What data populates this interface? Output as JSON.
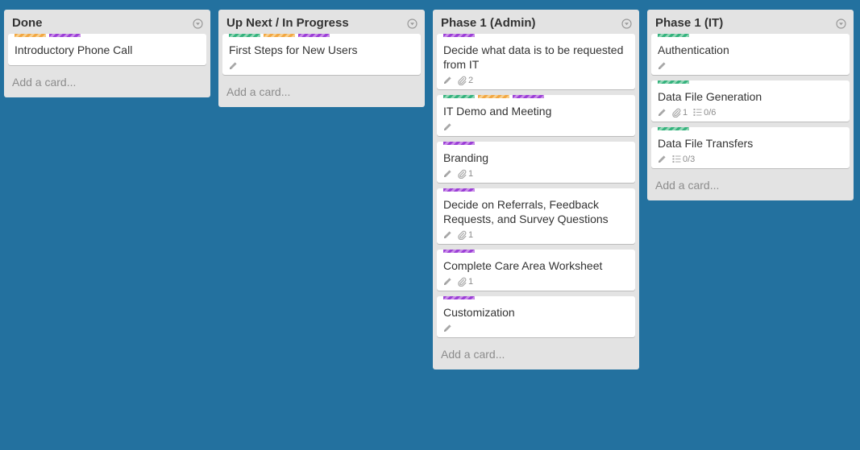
{
  "colors": {
    "board_background": "#23719f",
    "list_background": "#e3e3e3",
    "label_orange": "#f2a743",
    "label_purple": "#9b3ed6",
    "label_green": "#34b27d"
  },
  "add_card_label": "Add a card...",
  "lists": [
    {
      "title": "Done",
      "cards": [
        {
          "title": "Introductory Phone Call",
          "labels": [
            "orange",
            "purple"
          ],
          "badges": null
        }
      ]
    },
    {
      "title": "Up Next / In Progress",
      "cards": [
        {
          "title": "First Steps for New Users",
          "labels": [
            "green",
            "orange",
            "purple"
          ],
          "badges": {
            "description": true,
            "attachments": null,
            "checklist": null
          }
        }
      ]
    },
    {
      "title": "Phase 1 (Admin)",
      "cards": [
        {
          "title": "Decide what data is to be requested from IT",
          "labels": [
            "purple"
          ],
          "badges": {
            "description": true,
            "attachments": "2",
            "checklist": null
          }
        },
        {
          "title": "IT Demo and Meeting",
          "labels": [
            "green",
            "orange",
            "purple"
          ],
          "badges": {
            "description": true,
            "attachments": null,
            "checklist": null
          }
        },
        {
          "title": "Branding",
          "labels": [
            "purple"
          ],
          "badges": {
            "description": true,
            "attachments": "1",
            "checklist": null
          }
        },
        {
          "title": "Decide on Referrals, Feedback Requests, and Survey Questions",
          "labels": [
            "purple"
          ],
          "badges": {
            "description": true,
            "attachments": "1",
            "checklist": null
          }
        },
        {
          "title": "Complete Care Area Worksheet",
          "labels": [
            "purple"
          ],
          "badges": {
            "description": true,
            "attachments": "1",
            "checklist": null
          }
        },
        {
          "title": "Customization",
          "labels": [
            "purple"
          ],
          "badges": {
            "description": true,
            "attachments": null,
            "checklist": null
          }
        }
      ]
    },
    {
      "title": "Phase 1 (IT)",
      "cards": [
        {
          "title": "Authentication",
          "labels": [
            "green"
          ],
          "badges": {
            "description": true,
            "attachments": null,
            "checklist": null
          }
        },
        {
          "title": "Data File Generation",
          "labels": [
            "green"
          ],
          "badges": {
            "description": true,
            "attachments": "1",
            "checklist": "0/6"
          }
        },
        {
          "title": "Data File Transfers",
          "labels": [
            "green"
          ],
          "badges": {
            "description": true,
            "attachments": null,
            "checklist": "0/3"
          }
        }
      ]
    }
  ]
}
